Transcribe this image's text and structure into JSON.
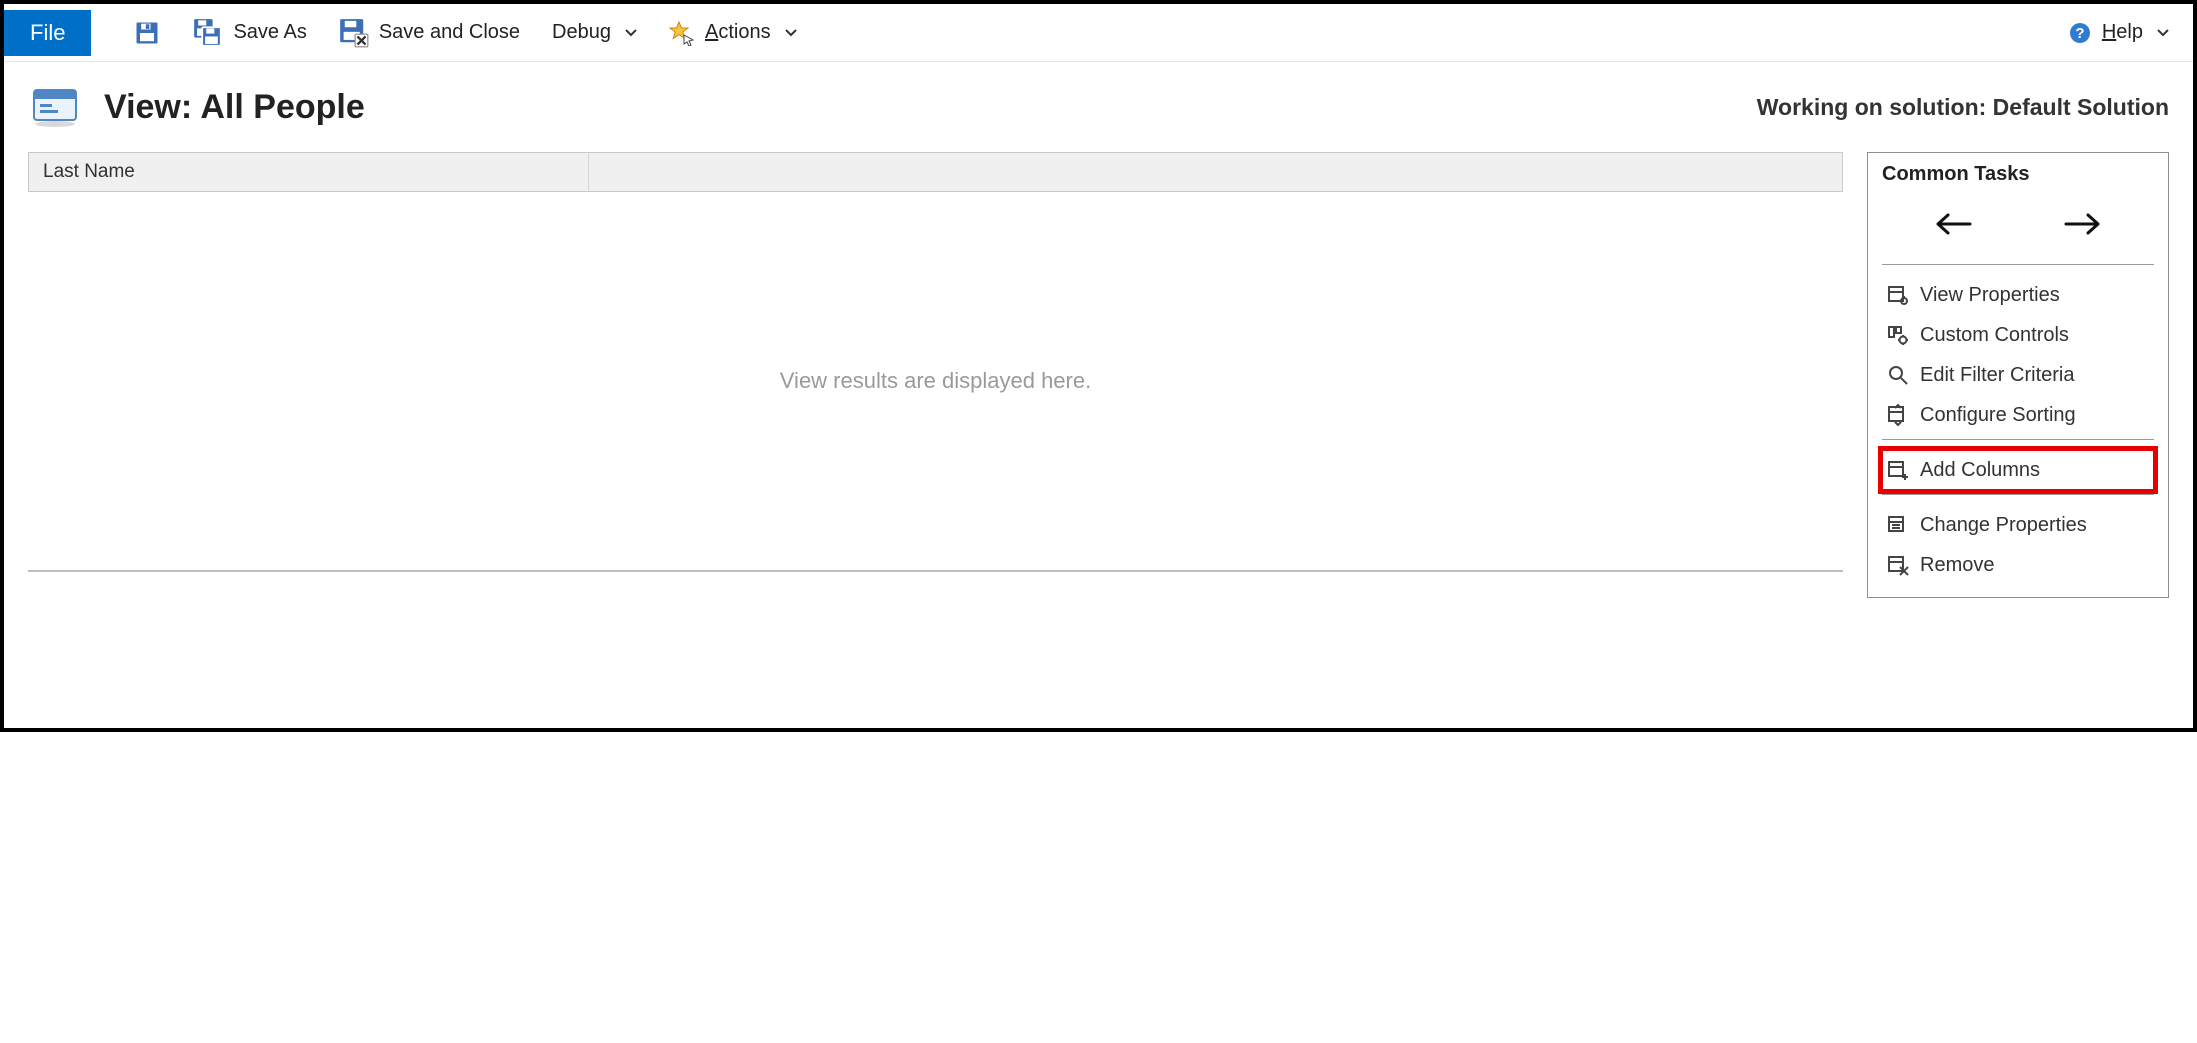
{
  "toolbar": {
    "file": "File",
    "save_as": "Save As",
    "save_and_close": "Save and Close",
    "debug": "Debug",
    "actions": "Actions",
    "help": "Help"
  },
  "header": {
    "title": "View: All People",
    "working_on": "Working on solution: Default Solution"
  },
  "grid": {
    "columns": [
      "Last Name"
    ],
    "placeholder": "View results are displayed here."
  },
  "tasks": {
    "heading": "Common Tasks",
    "items": {
      "view_properties": "View Properties",
      "custom_controls": "Custom Controls",
      "edit_filter_criteria": "Edit Filter Criteria",
      "configure_sorting": "Configure Sorting",
      "add_columns": "Add Columns",
      "change_properties": "Change Properties",
      "remove": "Remove"
    }
  }
}
